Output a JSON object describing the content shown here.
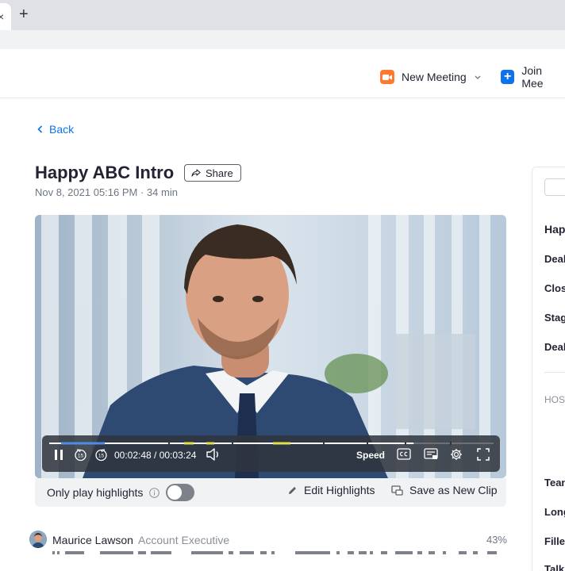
{
  "browser": {
    "tab_close": "×",
    "new_tab": "+"
  },
  "header": {
    "new_meeting": "New Meeting",
    "join_meeting": "Join Mee",
    "colors": {
      "new_meeting_icon": "#ff7a2f",
      "join_icon": "#0e72ed"
    }
  },
  "page": {
    "back": "Back",
    "title": "Happy ABC Intro",
    "share": "Share",
    "meta": "Nov 8, 2021 05:16 PM · 34 min"
  },
  "player": {
    "time": "00:02:48 / 00:03:24",
    "progress": 0.82,
    "speed": "Speed",
    "rewind_label": "15",
    "forward_label": "15"
  },
  "highlights": {
    "only_play": "Only play highlights",
    "toggle_on": false,
    "edit": "Edit Highlights",
    "save_clip": "Save as New Clip"
  },
  "speaker": {
    "name": "Maurice Lawson",
    "role": "Account Executive",
    "percent": "43%"
  },
  "panel": {
    "heading": "Hap",
    "labels": [
      "Deal",
      "Clos",
      "Stag",
      "Deal"
    ],
    "section": "HOS",
    "labels2": [
      "Tean",
      "Long",
      "Fille",
      "Talk"
    ]
  }
}
